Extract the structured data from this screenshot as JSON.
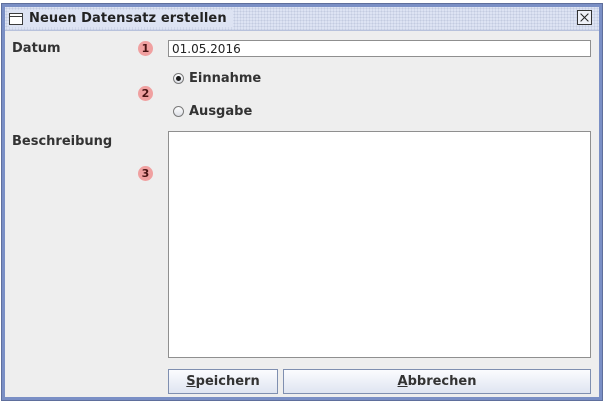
{
  "window": {
    "title": "Neuen Datensatz erstellen"
  },
  "form": {
    "datum_label": "Datum",
    "datum_value": "01.05.2016",
    "type_options": [
      {
        "label": "Einnahme",
        "selected": true
      },
      {
        "label": "Ausgabe",
        "selected": false
      }
    ],
    "beschreibung_label": "Beschreibung",
    "beschreibung_value": ""
  },
  "badges": [
    "1",
    "2",
    "3"
  ],
  "buttons": {
    "save": {
      "mnemonic": "S",
      "rest": "peichern"
    },
    "cancel": {
      "mnemonic": "A",
      "rest": "bbrechen"
    }
  },
  "colors": {
    "window_border": "#7a8fc5",
    "badge_fill": "#f0a0a0",
    "background": "#eeeeee"
  },
  "icons": {
    "window": "window-icon",
    "close": "close-icon"
  }
}
